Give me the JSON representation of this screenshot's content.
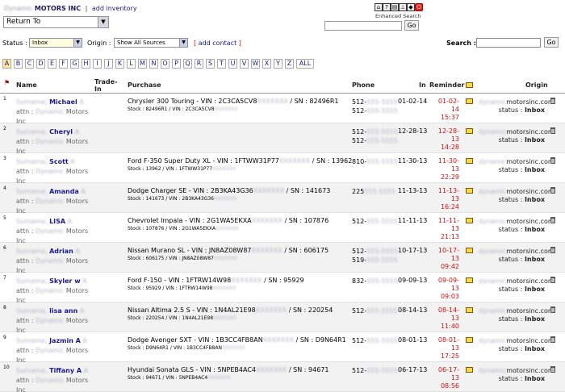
{
  "header": {
    "company": "MOTORS INC",
    "add_inventory": "add inventory",
    "return_to": "Return To",
    "enhanced_search_label": "Enhanced Search",
    "go": "Go"
  },
  "filters": {
    "status_label": "Status :",
    "status_value": "Inbox",
    "origin_label": "Origin :",
    "origin_value": "Show All Sources",
    "add_contact": "add contact",
    "search_label": "Search :",
    "go": "Go"
  },
  "alphabet": [
    "A",
    "B",
    "C",
    "D",
    "E",
    "F",
    "G",
    "H",
    "I",
    "J",
    "K",
    "L",
    "M",
    "N",
    "O",
    "P",
    "Q",
    "R",
    "S",
    "T",
    "U",
    "V",
    "W",
    "X",
    "Y",
    "Z",
    "ALL"
  ],
  "table": {
    "headers": {
      "name": "Name",
      "trade_in": "Trade-In",
      "purchase": "Purchase",
      "phone": "Phone",
      "in": "In",
      "reminder": "Reminder",
      "origin": "Origin"
    },
    "rows": [
      {
        "num": "1",
        "first": "Michael",
        "attn": "attn :",
        "co": "Motors",
        "inc": "Inc",
        "vehicle": "Chrysler 300 Touring - VIN : 2C3CA5CV8",
        "sn": "/ SN : 82496R1",
        "stock": "Stock : 82496R1 / VIN : 2C3CA5CV8",
        "phone1": "512-",
        "phone2": "512-",
        "in": "01-02-14",
        "rem_date": "01-02-14",
        "rem_time": "15:37",
        "origin_domain": "motorsinc.com",
        "origin_status": "status :",
        "status_value": "Inbox"
      },
      {
        "num": "2",
        "first": "Cheryl",
        "attn": "attn :",
        "co": "Motors",
        "inc": "Inc",
        "vehicle": "",
        "sn": "",
        "stock": "",
        "phone1": "512-",
        "phone2": "512-",
        "in": "12-28-13",
        "rem_date": "12-28-13",
        "rem_time": "14:28",
        "origin_domain": "motorsinc.com",
        "origin_status": "status :",
        "status_value": "Inbox"
      },
      {
        "num": "3",
        "first": "Scott",
        "attn": "attn :",
        "co": "Motors",
        "inc": "Inc",
        "vehicle": "Ford F-350 Super Duty XL - VIN : 1FTWW31P77",
        "sn": "/ SN : 13962",
        "stock": "Stock : 13962 / VIN : 1FTWW31P77",
        "phone1": "810-",
        "phone2": "",
        "in": "11-30-13",
        "rem_date": "11-30-13",
        "rem_time": "22:29",
        "origin_domain": "motorsinc.com",
        "origin_status": "status :",
        "status_value": "Inbox"
      },
      {
        "num": "4",
        "first": "Amanda",
        "attn": "attn :",
        "co": "Motors",
        "inc": "Inc",
        "vehicle": "Dodge Charger SE - VIN : 2B3KA43G36",
        "sn": "/ SN : 141673",
        "stock": "Stock : 141673 / VIN : 2B3KA43G36",
        "phone1": "225",
        "phone2": "",
        "in": "11-13-13",
        "rem_date": "11-13-13",
        "rem_time": "16:24",
        "origin_domain": "motorsinc.com",
        "origin_status": "status :",
        "status_value": "Inbox"
      },
      {
        "num": "5",
        "first": "LISA",
        "attn": "attn :",
        "co": "Motors",
        "inc": "Inc",
        "vehicle": "Chevrolet Impala - VIN : 2G1WA5EKXA",
        "sn": "/ SN : 107876",
        "stock": "Stock : 107876 / VIN : 2G1WA5EKXA",
        "phone1": "512-",
        "phone2": "",
        "in": "11-11-13",
        "rem_date": "11-11-13",
        "rem_time": "21:13",
        "origin_domain": "motorsinc.com",
        "origin_status": "status :",
        "status_value": "Inbox"
      },
      {
        "num": "6",
        "first": "Adrian",
        "attn": "attn :",
        "co": "Motors",
        "inc": "Inc",
        "vehicle": "Nissan Murano SL - VIN : JN8AZ08W87",
        "sn": "/ SN : 606175",
        "stock": "Stock : 606175 / VIN : JN8AZ08W87",
        "phone1": "512-",
        "phone2": "519-",
        "in": "10-17-13",
        "rem_date": "10-17-13",
        "rem_time": "09:42",
        "origin_domain": "motorsinc.com",
        "origin_status": "status :",
        "status_value": "Inbox"
      },
      {
        "num": "7",
        "first": "Skyler w",
        "attn": "attn :",
        "co": "Motors",
        "inc": "Inc",
        "vehicle": "Ford F-150 - VIN : 1FTRW14W98",
        "sn": "/ SN : 95929",
        "stock": "Stock : 95929 / VIN : 1FTRW14W98",
        "phone1": "832-",
        "phone2": "",
        "in": "09-09-13",
        "rem_date": "09-09-13",
        "rem_time": "09:03",
        "origin_domain": "motorsinc.com",
        "origin_status": "status :",
        "status_value": "Inbox"
      },
      {
        "num": "8",
        "first": "lisa ann",
        "attn": "attn :",
        "co": "Motors",
        "inc": "Inc",
        "vehicle": "Nissan Altima 2.5 S - VIN : 1N4AL21E98",
        "sn": "/ SN : 220254",
        "stock": "Stock : 220254 / VIN : 1N4AL21E98",
        "phone1": "512-",
        "phone2": "",
        "in": "08-14-13",
        "rem_date": "08-14-13",
        "rem_time": "11:40",
        "origin_domain": "motorsinc.com",
        "origin_status": "status :",
        "status_value": "Inbox"
      },
      {
        "num": "9",
        "first": "Jazmin A",
        "attn": "attn :",
        "co": "Motors",
        "inc": "Inc",
        "vehicle": "Dodge Avenger SXT - VIN : 1B3CC4FB8AN",
        "sn": "/ SN : D9N64R1",
        "stock": "Stock : D9N64R1 / VIN : 1B3CC4FB8AN",
        "phone1": "512-",
        "phone2": "",
        "in": "08-01-13",
        "rem_date": "08-01-13",
        "rem_time": "17:25",
        "origin_domain": "motorsinc.com",
        "origin_status": "status :",
        "status_value": "Inbox"
      },
      {
        "num": "10",
        "first": "Tiffany A",
        "attn": "attn :",
        "co": "Motors",
        "inc": "Inc",
        "vehicle": "Hyundai Sonata GLS - VIN : 5NPEB4AC4",
        "sn": "/ SN : 94671",
        "stock": "Stock : 94671 / VIN : 5NPEB4AC4",
        "phone1": "512-",
        "phone2": "",
        "in": "06-17-13",
        "rem_date": "06-17-13",
        "rem_time": "08:56",
        "origin_domain": "motorsinc.com",
        "origin_status": "status :",
        "status_value": "Inbox"
      }
    ]
  },
  "icons": {
    "toolbar": [
      "home-icon",
      "help-icon",
      "print-icon",
      "hierarchy-icon",
      "inventory-icon",
      "power-icon"
    ],
    "mail": "mail-icon",
    "trash": "trash-icon",
    "flag": "flag-icon"
  },
  "colors": {
    "link": "#1a1a8c",
    "reminder": "#cc1111",
    "active_letter": "#ffe89a"
  }
}
